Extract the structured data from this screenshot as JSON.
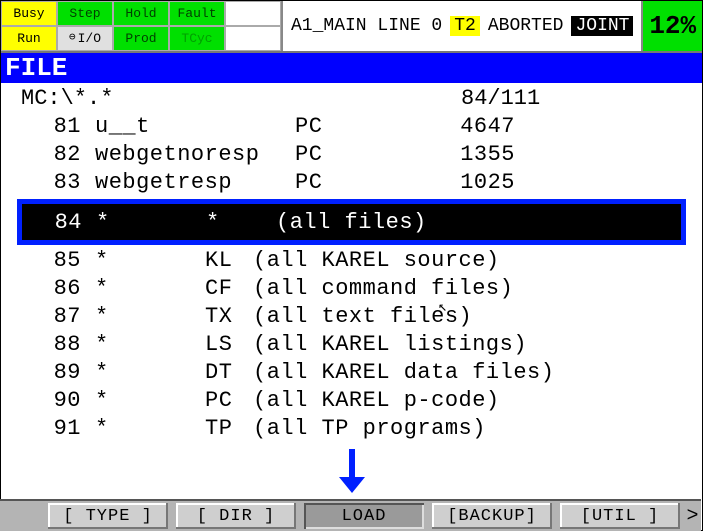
{
  "top": {
    "status": {
      "busy": "Busy",
      "step": "Step",
      "hold": "Hold",
      "fault": "Fault",
      "run": "Run",
      "io": "I/O",
      "prod": "Prod",
      "tcyc": "TCyc"
    },
    "line": {
      "prog": "A1_MAIN LINE 0",
      "t2": "T2",
      "state": "ABORTED",
      "mode": "JOINT"
    },
    "pct": "12%"
  },
  "title": "FILE",
  "path": "MC:\\*.*",
  "counter": "84/111",
  "files": [
    {
      "n": "81",
      "name": "u__t",
      "ext": "PC",
      "size": "4647"
    },
    {
      "n": "82",
      "name": "webgetnoresp",
      "ext": "PC",
      "size": "1355"
    },
    {
      "n": "83",
      "name": "webgetresp",
      "ext": "PC",
      "size": "1025"
    }
  ],
  "selected": {
    "n": "84",
    "name": "*",
    "ext": "*",
    "desc": "(all files)"
  },
  "filters": [
    {
      "n": "85",
      "name": "*",
      "ext": "KL",
      "desc": "(all KAREL source)"
    },
    {
      "n": "86",
      "name": "*",
      "ext": "CF",
      "desc": "(all command files)"
    },
    {
      "n": "87",
      "name": "*",
      "ext": "TX",
      "desc": "(all text files)"
    },
    {
      "n": "88",
      "name": "*",
      "ext": "LS",
      "desc": "(all KAREL listings)"
    },
    {
      "n": "89",
      "name": "*",
      "ext": "DT",
      "desc": "(all KAREL data files)"
    },
    {
      "n": "90",
      "name": "*",
      "ext": "PC",
      "desc": "(all KAREL p-code)"
    },
    {
      "n": "91",
      "name": "*",
      "ext": "TP",
      "desc": "(all TP programs)"
    }
  ],
  "footer": {
    "type": "[ TYPE ]",
    "dir": "[ DIR ]",
    "load": "LOAD",
    "backup": "[BACKUP]",
    "util": "[UTIL ]",
    "more": ">"
  }
}
